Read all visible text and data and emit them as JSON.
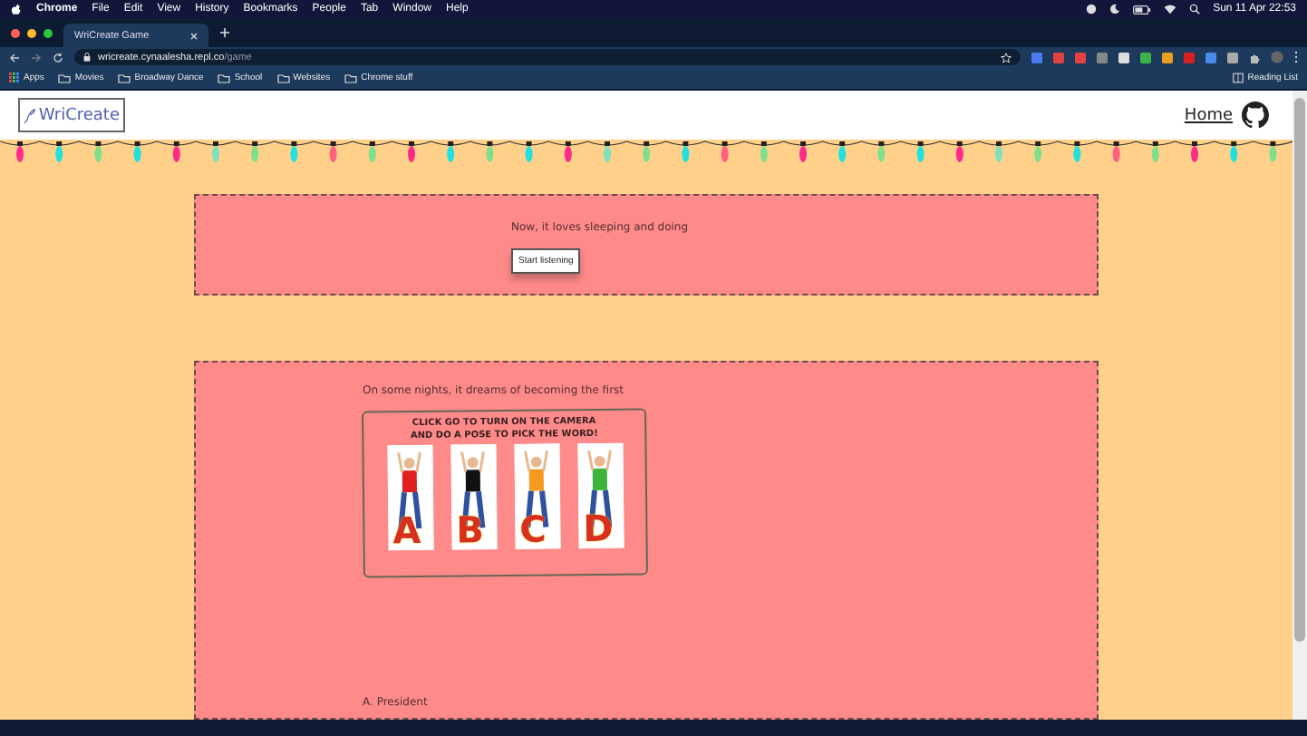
{
  "menu_bar": {
    "menus": [
      "Chrome",
      "File",
      "Edit",
      "View",
      "History",
      "Bookmarks",
      "People",
      "Tab",
      "Window",
      "Help"
    ],
    "clock": "Sun 11 Apr 22:53"
  },
  "browser": {
    "tabs": [
      {
        "title": "WriCreate Game",
        "selected": true
      }
    ],
    "address": {
      "host": "wricreate.cynaalesha.repl.co",
      "path": "/game"
    },
    "bookmarks": [
      {
        "label": "Apps",
        "kind": "apps"
      },
      {
        "label": "Movies",
        "kind": "folder"
      },
      {
        "label": "Broadway Dance",
        "kind": "folder"
      },
      {
        "label": "School",
        "kind": "folder"
      },
      {
        "label": "Websites",
        "kind": "folder"
      },
      {
        "label": "Chrome stuff",
        "kind": "folder"
      }
    ],
    "reading_list": "Reading List"
  },
  "site": {
    "logo": "WriCreate",
    "home": "Home"
  },
  "cards": [
    {
      "prompt": "Now, it loves sleeping and doing",
      "button": "Start listening"
    },
    {
      "prompt": "On some nights, it dreams of becoming the first",
      "picture": {
        "caption_lines": [
          "CLICK GO TO TURN ON THE CAMERA",
          "AND DO A POSE TO PICK THE WORD!"
        ],
        "letters": [
          "A",
          "B",
          "C",
          "D"
        ]
      },
      "options": [
        "A. President"
      ]
    }
  ]
}
